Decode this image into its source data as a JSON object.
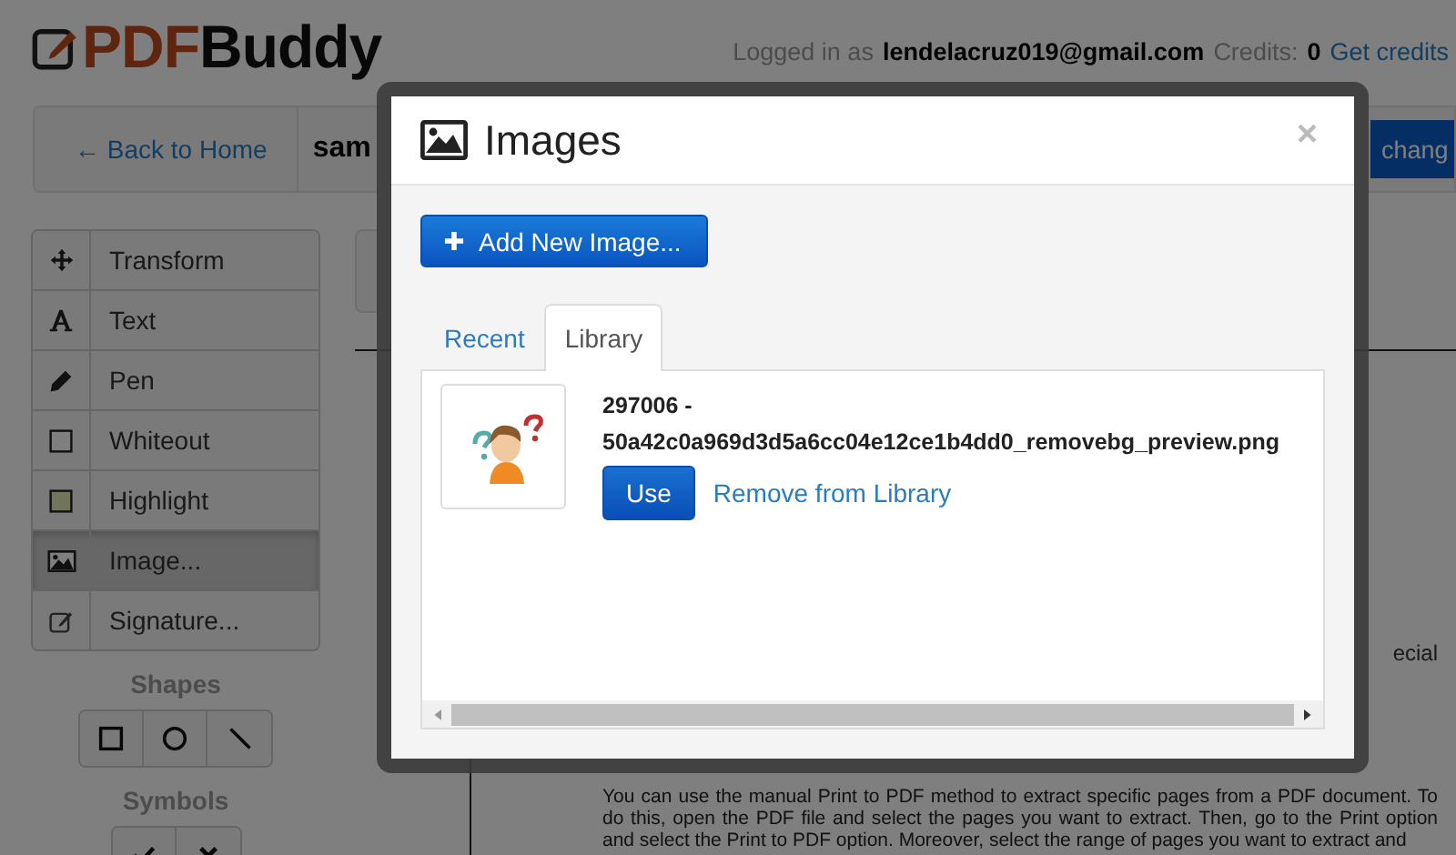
{
  "header": {
    "logo_prefix": "PDF",
    "logo_suffix": "Buddy",
    "login_label": "Logged in as",
    "email": "lendelacruz019@gmail.com",
    "credits_label": "Credits:",
    "credits_value": "0",
    "get_credits": "Get credits"
  },
  "toolbar": {
    "back_link": "← Back to Home",
    "filename": "sam",
    "action_button": "chang"
  },
  "tools": [
    {
      "label": "Transform",
      "selected": false
    },
    {
      "label": "Text",
      "selected": false
    },
    {
      "label": "Pen",
      "selected": false
    },
    {
      "label": "Whiteout",
      "selected": false
    },
    {
      "label": "Highlight",
      "selected": false
    },
    {
      "label": "Image...",
      "selected": true
    },
    {
      "label": "Signature...",
      "selected": false
    }
  ],
  "shapes": {
    "label": "Shapes"
  },
  "symbols": {
    "label": "Symbols"
  },
  "document": {
    "fragment": "ecial",
    "paragraph": "You can use the manual Print to PDF method to extract specific pages from a PDF document. To do this, open the PDF file and select the pages you want to extract. Then, go to the Print option and select the Print to PDF option. Moreover, select the range of pages you want to extract and"
  },
  "modal": {
    "title": "Images",
    "close": "×",
    "add_button": "Add New Image...",
    "tabs": [
      {
        "label": "Recent",
        "selected": false
      },
      {
        "label": "Library",
        "selected": true
      }
    ],
    "items": [
      {
        "kind": "picture",
        "title": "297006 - 50a42c0a969d3d5a6cc04e12ce1b4dd0_removebg_preview.png",
        "use_button": "Use",
        "remove_link": "Remove from Library"
      }
    ]
  }
}
